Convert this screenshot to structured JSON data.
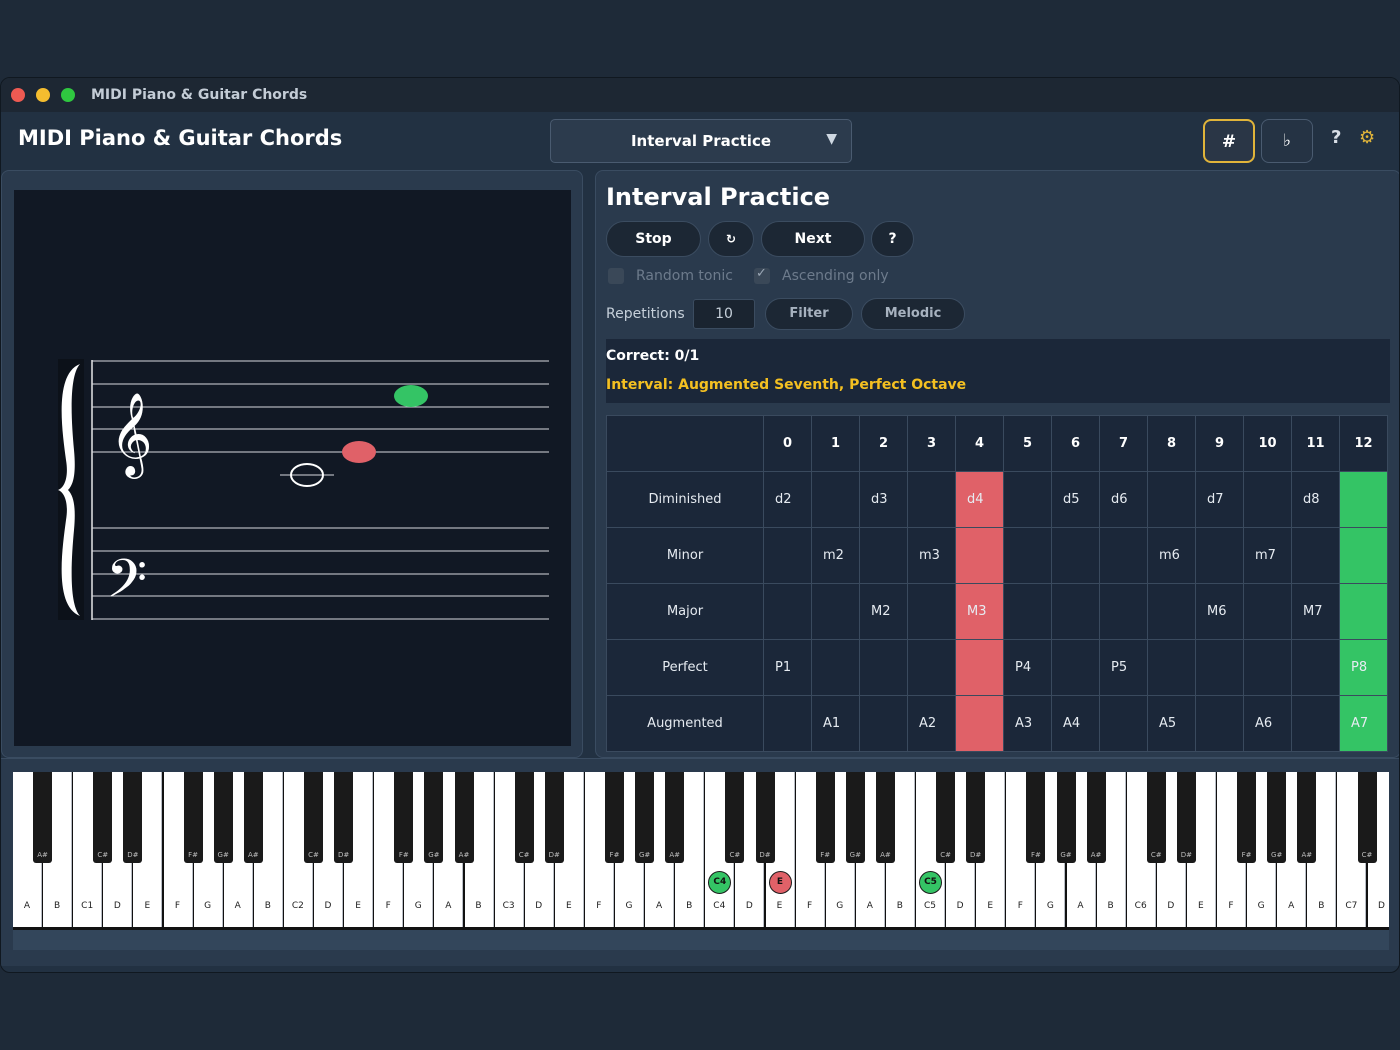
{
  "window": {
    "title": "MIDI Piano & Guitar Chords"
  },
  "header": {
    "app_title": "MIDI Piano & Guitar Chords",
    "mode": "Interval Practice",
    "sharp_label": "#",
    "flat_label": "♭",
    "help_label": "?",
    "settings_label": "⚙"
  },
  "colors": {
    "accent": "#e0b43a",
    "wrong": "#e06168",
    "correct": "#34c465",
    "interval_text": "#f4c021"
  },
  "practice": {
    "title": "Interval Practice",
    "stop": "Stop",
    "replay": "↻",
    "next": "Next",
    "help": "?",
    "random_tonic": "Random tonic",
    "random_tonic_checked": false,
    "ascending_only": "Ascending only",
    "ascending_only_checked": true,
    "repetitions_label": "Repetitions",
    "repetitions_value": "10",
    "filter": "Filter",
    "melodic": "Melodic",
    "correct": "Correct: 0/1",
    "interval": "Interval: Augmented Seventh, Perfect Octave"
  },
  "grid": {
    "columns": [
      "0",
      "1",
      "2",
      "3",
      "4",
      "5",
      "6",
      "7",
      "8",
      "9",
      "10",
      "11",
      "12"
    ],
    "rows": [
      {
        "name": "Diminished",
        "cells": [
          "d2",
          "",
          "d3",
          "",
          "d4",
          "",
          "d5",
          "d6",
          "",
          "d7",
          "",
          "d8",
          ""
        ]
      },
      {
        "name": "Minor",
        "cells": [
          "",
          "m2",
          "",
          "m3",
          "",
          "",
          "",
          "",
          "m6",
          "",
          "m7",
          "",
          ""
        ]
      },
      {
        "name": "Major",
        "cells": [
          "",
          "",
          "M2",
          "",
          "M3",
          "",
          "",
          "",
          "",
          "M6",
          "",
          "M7",
          ""
        ]
      },
      {
        "name": "Perfect",
        "cells": [
          "P1",
          "",
          "",
          "",
          "",
          "P4",
          "",
          "P5",
          "",
          "",
          "",
          "",
          "P8"
        ]
      },
      {
        "name": "Augmented",
        "cells": [
          "",
          "A1",
          "",
          "A2",
          "",
          "A3",
          "A4",
          "",
          "A5",
          "",
          "A6",
          "",
          "A7"
        ]
      }
    ],
    "wrong_column": 4,
    "correct_column": 12
  },
  "score": {
    "clefs": [
      "treble-clef",
      "bass-clef"
    ],
    "notes": [
      {
        "pitch": "C4",
        "state": "open"
      },
      {
        "pitch": "E4",
        "state": "wrong"
      },
      {
        "pitch": "C5",
        "state": "correct"
      }
    ]
  },
  "piano": {
    "white_keys": [
      "A",
      "B",
      "C1",
      "D",
      "E",
      "F",
      "G",
      "A",
      "B",
      "C2",
      "D",
      "E",
      "F",
      "G",
      "A",
      "B",
      "C3",
      "D",
      "E",
      "F",
      "G",
      "A",
      "B",
      "C4",
      "D",
      "E",
      "F",
      "G",
      "A",
      "B",
      "C5",
      "D",
      "E",
      "F",
      "G",
      "A",
      "B",
      "C6",
      "D",
      "E",
      "F",
      "G",
      "A",
      "B",
      "C7",
      "D"
    ],
    "black_keys": [
      "A#",
      "C#",
      "D#",
      "F#",
      "G#",
      "A#",
      "C#",
      "D#",
      "F#",
      "G#",
      "A#",
      "C#",
      "D#",
      "F#",
      "G#",
      "A#",
      "C#",
      "D#",
      "F#",
      "G#",
      "A#",
      "C#",
      "D#",
      "F#",
      "G#",
      "A#",
      "C#",
      "D#",
      "F#",
      "G#",
      "A#",
      "C#"
    ],
    "markers": [
      {
        "label": "C4",
        "state": "correct"
      },
      {
        "label": "E",
        "state": "wrong"
      },
      {
        "label": "C5",
        "state": "correct"
      }
    ]
  }
}
